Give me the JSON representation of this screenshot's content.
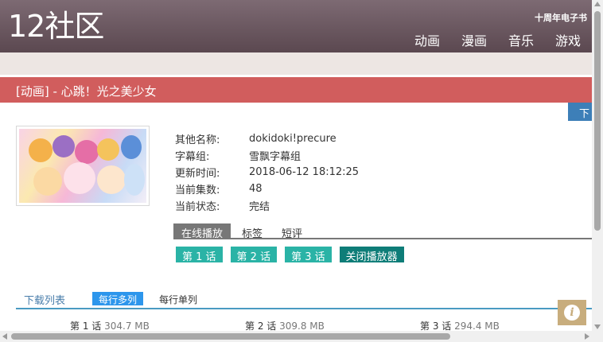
{
  "header": {
    "logo": "12社区",
    "tagline": "十周年电子书",
    "nav": [
      "动画",
      "漫画",
      "音乐",
      "游戏"
    ]
  },
  "title_bar": "[动画] - 心跳！光之美少女",
  "download_button": "下",
  "info": {
    "rows": [
      {
        "label": "其他名称:",
        "value": "dokidoki!precure"
      },
      {
        "label": "字幕组:",
        "value": "雪飘字幕组"
      },
      {
        "label": "更新时间:",
        "value": "2018-06-12 18:12:25"
      },
      {
        "label": "当前集数:",
        "value": "48"
      },
      {
        "label": "当前状态:",
        "value": "完结"
      }
    ]
  },
  "tabs": [
    "在线播放",
    "标签",
    "短评"
  ],
  "episodes": [
    "第 1 话",
    "第 2 话",
    "第 3 话"
  ],
  "close_player": "关闭播放器",
  "download_list": {
    "title": "下载列表",
    "option_multi": "每行多列",
    "option_single": "每行单列",
    "items": [
      {
        "name": "第 1 话",
        "size": "304.7 MB"
      },
      {
        "name": "第 2 话",
        "size": "309.8 MB"
      },
      {
        "name": "第 3 话",
        "size": "294.4 MB"
      }
    ]
  },
  "info_icon": "i",
  "colors": {
    "header": "#6b5861",
    "title_bar": "#d15d5d",
    "episode_button": "#2ab3a6",
    "close_button": "#0e7d78",
    "active_option": "#2d96ec",
    "download_button": "#3d7fb8"
  }
}
